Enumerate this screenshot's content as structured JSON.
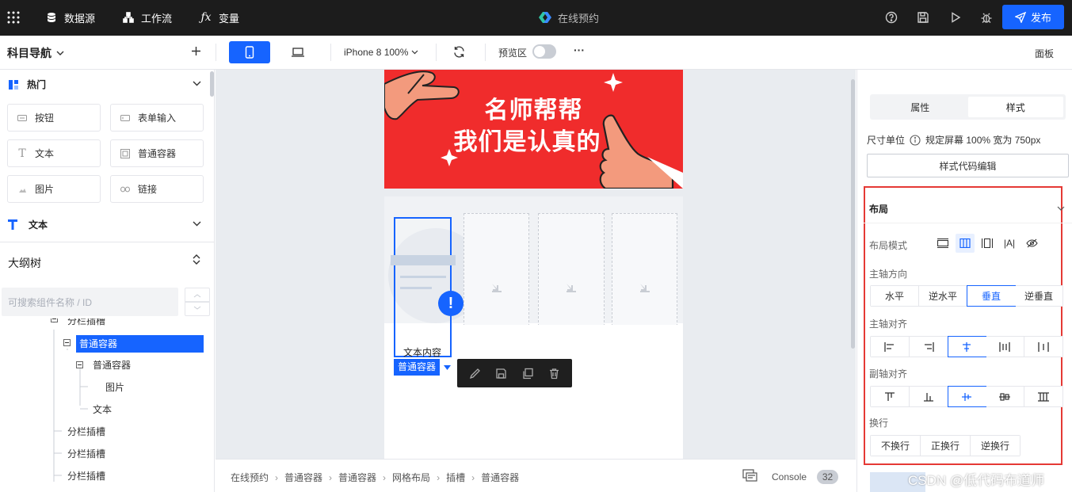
{
  "topbar": {
    "grid_icon": "grid-icon",
    "menus": [
      {
        "label": "数据源",
        "icon": "database-icon"
      },
      {
        "label": "工作流",
        "icon": "workflow-icon"
      },
      {
        "label": "变量",
        "icon": "fx-icon"
      }
    ],
    "app_title": "在线预约",
    "publish_label": "发布",
    "colors": {
      "bg": "#1c1c1c",
      "accent": "#1664ff",
      "highlight_box": "#e53935"
    }
  },
  "toolbar": {
    "nav_title": "科目导航",
    "device_label": "iPhone 8 100%",
    "preview_label": "预览区",
    "more_label": "···",
    "panel_label": "面板"
  },
  "left": {
    "hot_section": "热门",
    "components": [
      {
        "label": "按钮",
        "icon": "button-icon"
      },
      {
        "label": "表单输入",
        "icon": "input-icon"
      },
      {
        "label": "文本",
        "icon": "text-icon"
      },
      {
        "label": "普通容器",
        "icon": "container-icon"
      },
      {
        "label": "图片",
        "icon": "image-icon"
      },
      {
        "label": "链接",
        "icon": "link-icon"
      }
    ],
    "text_section": "文本",
    "outline_title": "大纲树",
    "search_placeholder": "可搜索组件名称 / ID",
    "tree": [
      {
        "label": "分栏插槽",
        "partial": true
      },
      {
        "label": "普通容器",
        "selected": true
      },
      {
        "label": "普通容器"
      },
      {
        "label": "图片"
      },
      {
        "label": "文本"
      },
      {
        "label": "分栏插槽"
      },
      {
        "label": "分栏插槽"
      },
      {
        "label": "分栏插槽"
      }
    ]
  },
  "canvas": {
    "banner_line1": "名师帮帮",
    "banner_line2": "我们是认真的",
    "text_content": "文本内容",
    "selected_tag": "普通容器",
    "banner_color": "#f02c2c"
  },
  "breadcrumb": {
    "items": [
      "在线预约",
      "普通容器",
      "普通容器",
      "网格布局",
      "插槽",
      "普通容器"
    ],
    "console_label": "Console",
    "console_count": "32"
  },
  "right": {
    "tabs": [
      "属性",
      "样式"
    ],
    "active_tab": "样式",
    "size_unit_label": "尺寸单位",
    "size_unit_value": "规定屏幕 100% 宽为 750px",
    "code_edit_label": "样式代码编辑",
    "layout_title": "布局",
    "layout_mode_label": "布局模式",
    "main_dir_label": "主轴方向",
    "main_dir_options": [
      "水平",
      "逆水平",
      "垂直",
      "逆垂直"
    ],
    "main_dir_selected": "垂直",
    "main_align_label": "主轴对齐",
    "cross_align_label": "副轴对齐",
    "wrap_label": "换行",
    "wrap_options": [
      "不换行",
      "正换行",
      "逆换行"
    ]
  },
  "watermark": "CSDN @低代码布道师"
}
